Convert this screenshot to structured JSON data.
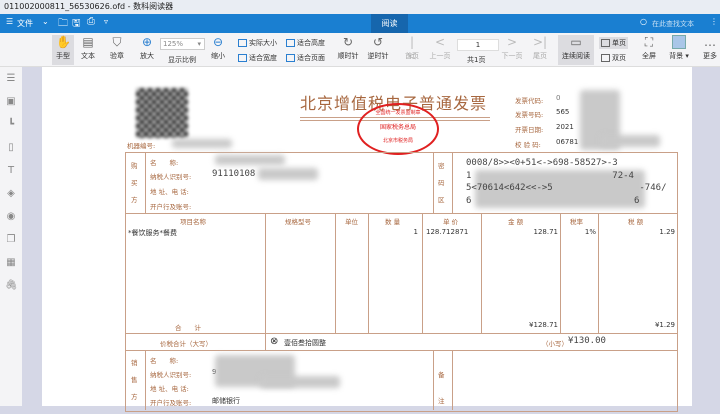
{
  "window": {
    "title": "011002000811_56530626.ofd - 数科阅读器"
  },
  "menubar": {
    "file_label": "文件",
    "active_tab": "阅读",
    "search_placeholder": "在此查找文本"
  },
  "toolbar": {
    "hand": "手型",
    "text": "文本",
    "verify": "验章",
    "zoom_in": "放大",
    "zoom_value": "125%",
    "zoom_label": "显示比例",
    "zoom_out": "缩小",
    "actual_size": "实际大小",
    "fit_width": "适合宽度",
    "fit_height": "适合高度",
    "fit_page": "适合页面",
    "rotate_cw": "顺时针",
    "rotate_ccw": "逆时针",
    "first_page": "首页",
    "prev_page": "上一页",
    "page_value": "1",
    "total_pages": "共1页",
    "next_page": "下一页",
    "last_page": "尾页",
    "continuous": "连续阅读",
    "single_page": "单页",
    "double_page": "双页",
    "fullscreen": "全屏",
    "background": "背景",
    "more": "更多"
  },
  "invoice": {
    "title": "北京增值税电子普通发票",
    "stamp_top": "全国统一发票监制章",
    "stamp_mid": "国家税务总局",
    "stamp_bottom": "北京市税务局",
    "code_label": "发票代码:",
    "code_value": "0",
    "number_label": "发票号码:",
    "number_value": "565",
    "date_label": "开票日期:",
    "date_value": "2021",
    "check_label": "校 验 码:",
    "check_value": "06781",
    "machine_label": "机器编号:",
    "buyer_side": "购买方",
    "seller_side": "销售方",
    "name_label": "名　　称:",
    "taxid_label": "纳税人识别号:",
    "addr_label": "地 址、电 话:",
    "bank_label": "开户行及账号:",
    "buyer_taxid": "91110108",
    "seller_taxid": "9",
    "seller_bank": "邮储银行",
    "cipher_label": "密码区",
    "cipher": [
      "0008/8>><0+51<->698-58527>-3",
      "1                          72-4",
      "5<70614<642<<->5                -746/",
      "6                              6"
    ],
    "headers": [
      "项目名称",
      "规格型号",
      "单位",
      "数 量",
      "单 价",
      "金 额",
      "税率",
      "税 额"
    ],
    "items": [
      {
        "name": "*餐饮服务*餐费",
        "spec": "",
        "unit": "",
        "qty": "1",
        "price": "128.712871",
        "amount": "128.71",
        "rate": "1%",
        "tax": "1.29"
      }
    ],
    "total_label": "合　　计",
    "total_amount": "¥128.71",
    "total_tax": "¥1.29",
    "grand_label": "价税合计（大写）",
    "grand_words": "壹佰叁拾圆整",
    "grand_small_label": "（小写）",
    "grand_small": "¥130.00",
    "remark_label": "备注"
  }
}
